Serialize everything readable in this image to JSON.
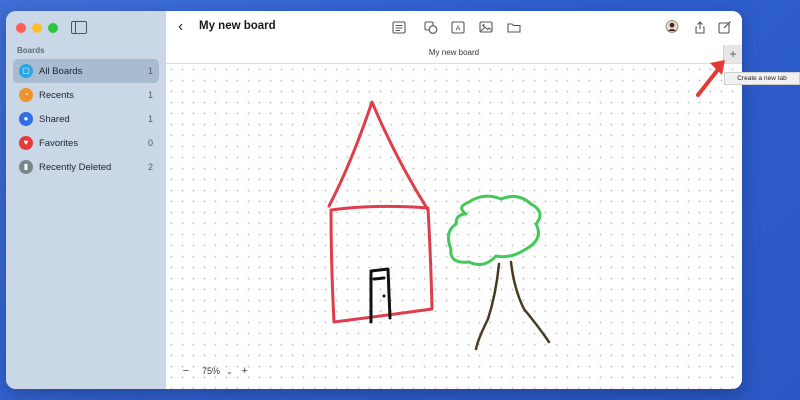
{
  "sidebar": {
    "section_label": "Boards",
    "items": [
      {
        "label": "All Boards",
        "count": "1",
        "icon": "all-boards-icon",
        "color": "#2aa7e8",
        "glyph": "▢",
        "active": true
      },
      {
        "label": "Recents",
        "count": "1",
        "icon": "clock-icon",
        "color": "#f0922a",
        "glyph": "◔",
        "active": false
      },
      {
        "label": "Shared",
        "count": "1",
        "icon": "people-icon",
        "color": "#2f6fe4",
        "glyph": "●",
        "active": false
      },
      {
        "label": "Favorites",
        "count": "0",
        "icon": "heart-icon",
        "color": "#e63b3b",
        "glyph": "♥",
        "active": false
      },
      {
        "label": "Recently Deleted",
        "count": "2",
        "icon": "trash-icon",
        "color": "#7d8590",
        "glyph": "▮",
        "active": false
      }
    ]
  },
  "toolbar": {
    "title": "My new board"
  },
  "tabbar": {
    "tab_title": "My new board",
    "new_tab_label": "+"
  },
  "tooltip": {
    "text": "Create a new tab"
  },
  "zoom": {
    "minus": "−",
    "value": "75%",
    "chevron": "⌄",
    "plus": "+"
  },
  "colors": {
    "accent": "#e53935",
    "house": "#e03d4a",
    "tree_leaves": "#43c85a",
    "trunk": "#4a3a20",
    "door": "#111111"
  }
}
